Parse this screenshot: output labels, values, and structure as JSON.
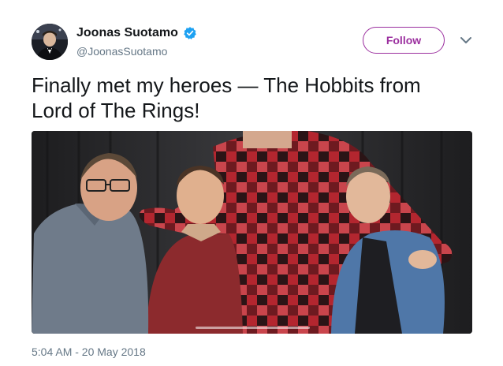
{
  "author": {
    "name": "Joonas Suotamo",
    "handle": "@JoonasSuotamo",
    "verified": true,
    "avatar_icon": "profile-photo"
  },
  "follow_button": {
    "label": "Follow",
    "color": "#9b2f9f"
  },
  "menu": {
    "icon": "chevron-down-icon"
  },
  "tweet": {
    "text": "Finally met my heroes — The Hobbits from\nLord of The Rings!",
    "timestamp": "5:04 AM - 20 May 2018"
  },
  "photo": {
    "icon": "photo-image"
  },
  "colors": {
    "accent": "#9b2f9f",
    "verified_blue": "#1da1f2",
    "secondary_text": "#657786",
    "primary_text": "#14171a"
  }
}
